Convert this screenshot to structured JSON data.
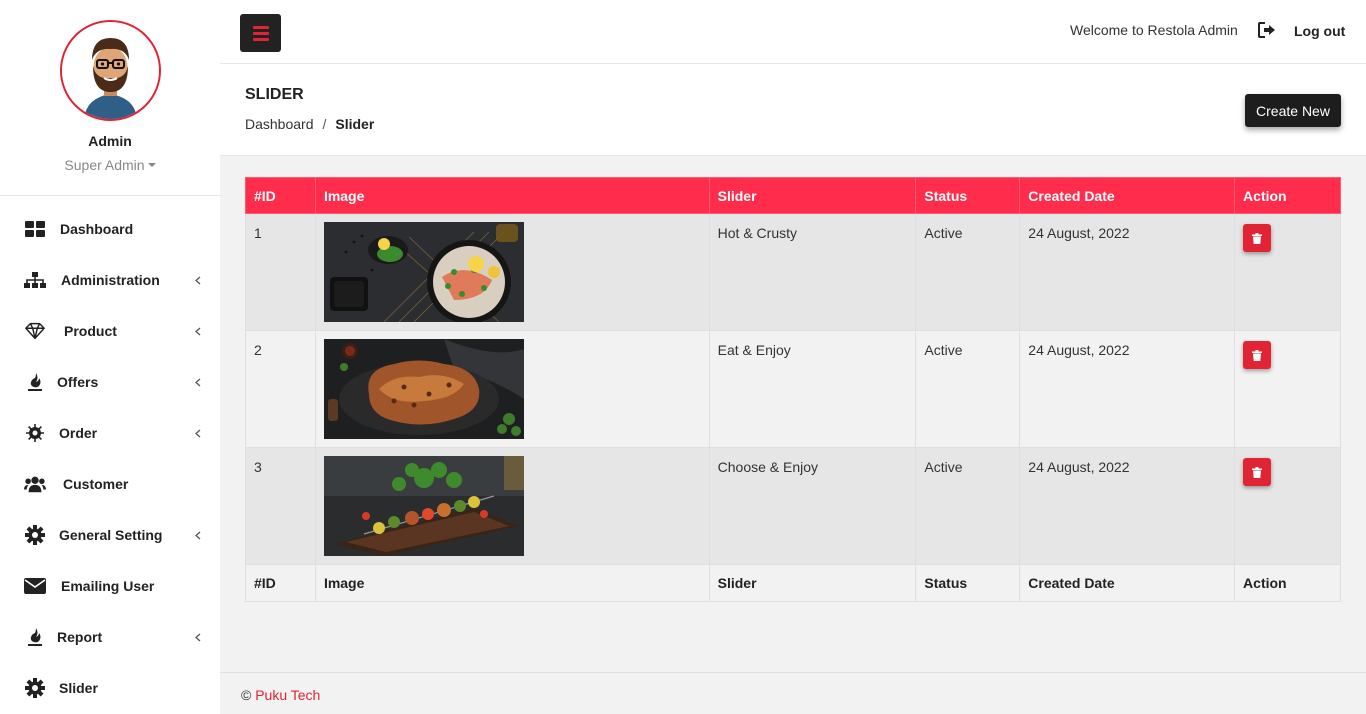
{
  "app_title": "Restola Admin",
  "profile": {
    "name": "Admin",
    "role": "Super Admin"
  },
  "sidebar": {
    "items": [
      {
        "label": "Dashboard",
        "icon": "dashboard-icon",
        "has_submenu": false
      },
      {
        "label": "Administration",
        "icon": "sitemap-icon",
        "has_submenu": true
      },
      {
        "label": "Product",
        "icon": "diamond-icon",
        "has_submenu": true
      },
      {
        "label": "Offers",
        "icon": "fire-icon",
        "has_submenu": true
      },
      {
        "label": "Order",
        "icon": "order-icon",
        "has_submenu": true
      },
      {
        "label": "Customer",
        "icon": "users-icon",
        "has_submenu": false
      },
      {
        "label": "General Setting",
        "icon": "gear-icon",
        "has_submenu": true
      },
      {
        "label": "Emailing User",
        "icon": "envelope-icon",
        "has_submenu": false
      },
      {
        "label": "Report",
        "icon": "fire-icon",
        "has_submenu": true
      },
      {
        "label": "Slider",
        "icon": "gear-icon",
        "has_submenu": false
      }
    ]
  },
  "topbar": {
    "welcome": "Welcome to Restola Admin",
    "logout_label": "Log out"
  },
  "page": {
    "title": "SLIDER",
    "breadcrumb": {
      "home": "Dashboard",
      "separator": "/",
      "current": "Slider"
    },
    "create_label": "Create New"
  },
  "table": {
    "columns": [
      "#ID",
      "Image",
      "Slider",
      "Status",
      "Created Date",
      "Action"
    ],
    "rows": [
      {
        "id": "1",
        "slider": "Hot & Crusty",
        "status": "Active",
        "created": "24 August, 2022",
        "image": "grilled fish with rice and lemon"
      },
      {
        "id": "2",
        "slider": "Eat & Enjoy",
        "status": "Active",
        "created": "24 August, 2022",
        "image": "roasted chicken on dark board"
      },
      {
        "id": "3",
        "slider": "Choose & Enjoy",
        "status": "Active",
        "created": "24 August, 2022",
        "image": "vegetable kebab skewers"
      }
    ]
  },
  "footer": {
    "copyright": "©",
    "company": "Puku Tech"
  },
  "colors": {
    "accent": "#e12433",
    "table_header": "#ff2d4b",
    "dark": "#1d1d1d"
  }
}
